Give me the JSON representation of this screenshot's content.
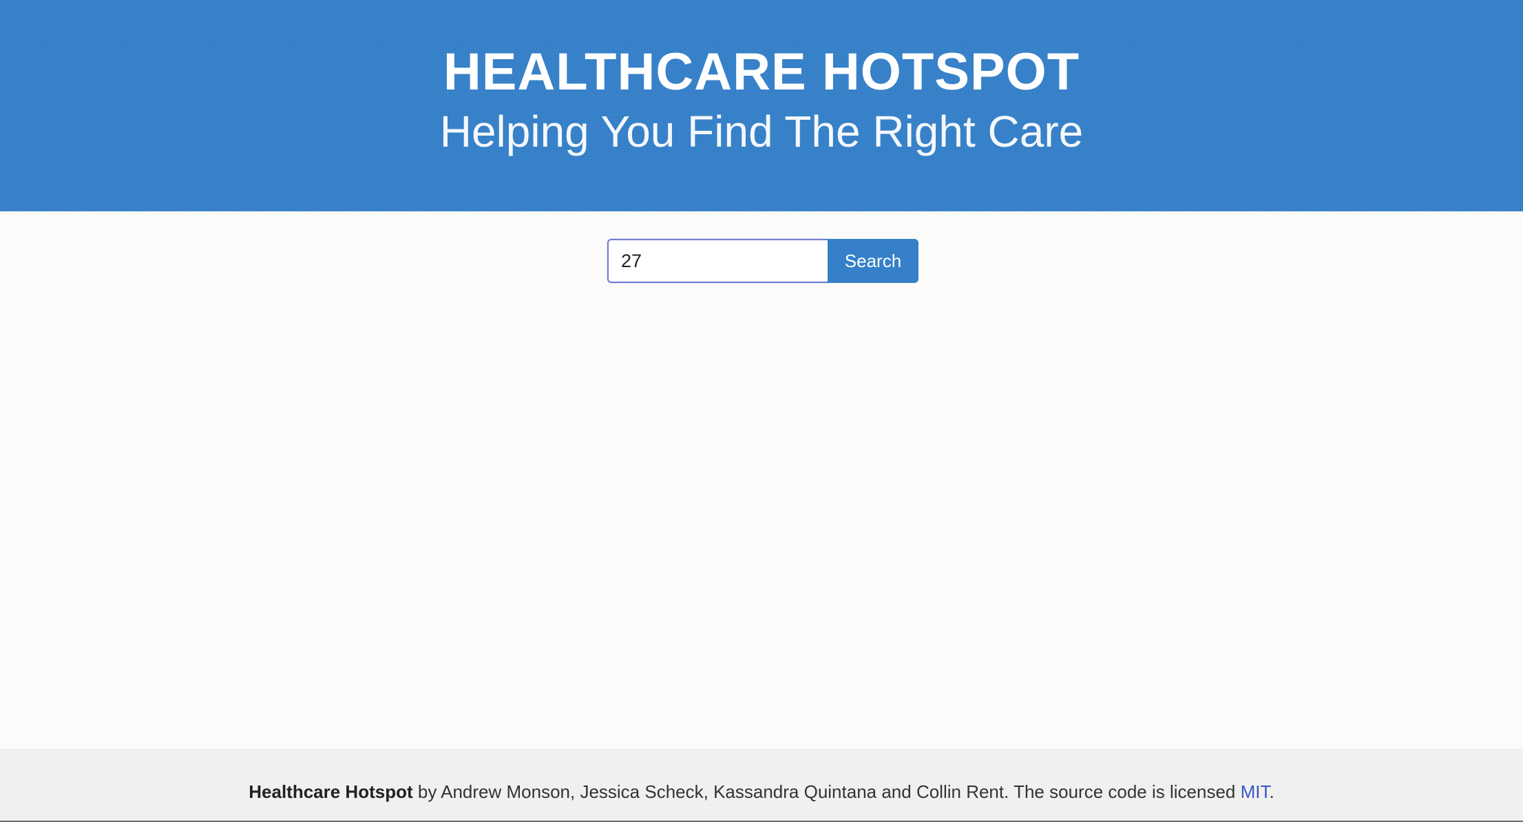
{
  "header": {
    "title": "HEALTHCARE HOTSPOT",
    "subtitle": "Helping You Find The Right Care"
  },
  "search": {
    "value": "27",
    "button_label": "Search"
  },
  "footer": {
    "brand": "Healthcare Hotspot",
    "text": " by Andrew Monson, Jessica Scheck, Kassandra Quintana and Collin Rent. The source code is licensed ",
    "license_link": "MIT",
    "end": "."
  },
  "colors": {
    "brand_blue": "#3580c8",
    "link_blue": "#3a56c4",
    "page_background": "#fbfbfa"
  }
}
